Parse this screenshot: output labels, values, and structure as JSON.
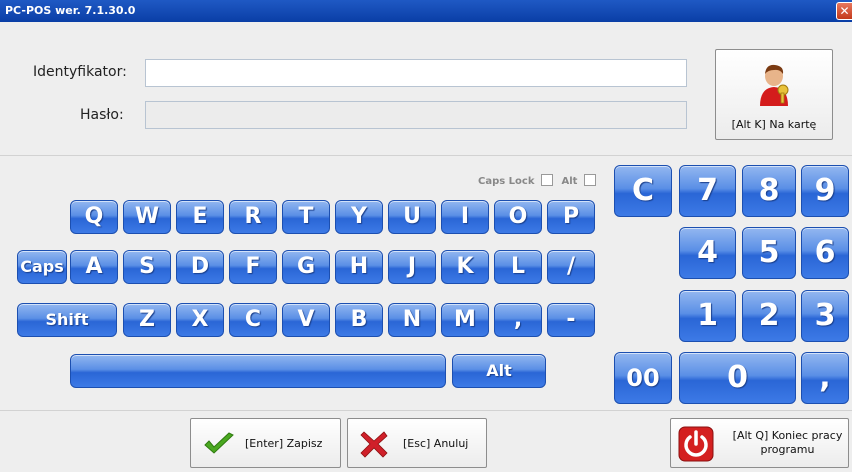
{
  "window": {
    "title": "PC-POS wer. 7.1.30.0",
    "close_symbol": "✕"
  },
  "login": {
    "identifier_label": "Identyfikator:",
    "identifier_value": "",
    "password_label": "Hasło:",
    "password_value": "",
    "card_button_label": "[Alt K] Na kartę",
    "card_icon": "user-key-icon"
  },
  "options": {
    "caps_lock_label": "Caps Lock",
    "caps_lock_checked": false,
    "alt_label": "Alt",
    "alt_checked": false
  },
  "keyboard": {
    "row1": [
      "Q",
      "W",
      "E",
      "R",
      "T",
      "Y",
      "U",
      "I",
      "O",
      "P"
    ],
    "row2": [
      "Caps",
      "A",
      "S",
      "D",
      "F",
      "G",
      "H",
      "J",
      "K",
      "L",
      "/"
    ],
    "row3": [
      "Shift",
      "Z",
      "X",
      "C",
      "V",
      "B",
      "N",
      "M",
      ",",
      "-"
    ],
    "row4": [
      "",
      "Alt"
    ]
  },
  "numpad": {
    "keys": [
      "C",
      "7",
      "8",
      "9",
      "4",
      "5",
      "6",
      "1",
      "2",
      "3",
      "00",
      "0",
      ","
    ]
  },
  "bottom": {
    "save_label": "[Enter] Zapisz",
    "cancel_label": "[Esc] Anuluj",
    "quit_label_line1": "[Alt Q] Koniec pracy",
    "quit_label_line2": "programu"
  },
  "colors": {
    "key_blue": "#2a66d6",
    "title_blue": "#0a3ea6",
    "check_green": "#4aa820",
    "cross_red": "#d0202a",
    "power_red": "#d42020"
  }
}
